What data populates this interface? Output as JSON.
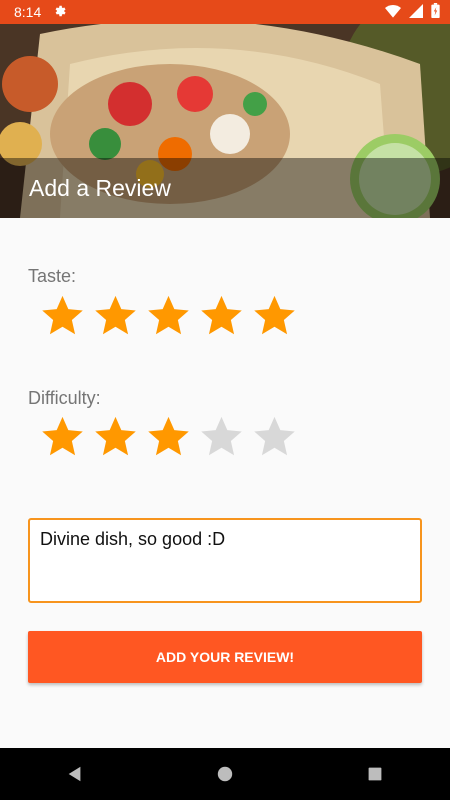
{
  "status_bar": {
    "time": "8:14"
  },
  "header": {
    "title": "Add a Review"
  },
  "ratings": {
    "taste": {
      "label": "Taste:",
      "value": 5,
      "max": 5
    },
    "difficulty": {
      "label": "Difficulty:",
      "value": 3,
      "max": 5
    }
  },
  "review": {
    "text": "Divine dish, so good :D"
  },
  "submit": {
    "label": "ADD YOUR REVIEW!"
  },
  "colors": {
    "status_bar": "#e64a19",
    "accent": "#ff5722",
    "star_filled": "#ff9800",
    "star_empty": "#d8d8d8",
    "input_border": "#f7941d"
  },
  "icons": {
    "status": [
      "settings-icon",
      "wifi-icon",
      "signal-icon",
      "battery-icon"
    ],
    "nav": [
      "back-icon",
      "home-icon",
      "recents-icon"
    ]
  }
}
